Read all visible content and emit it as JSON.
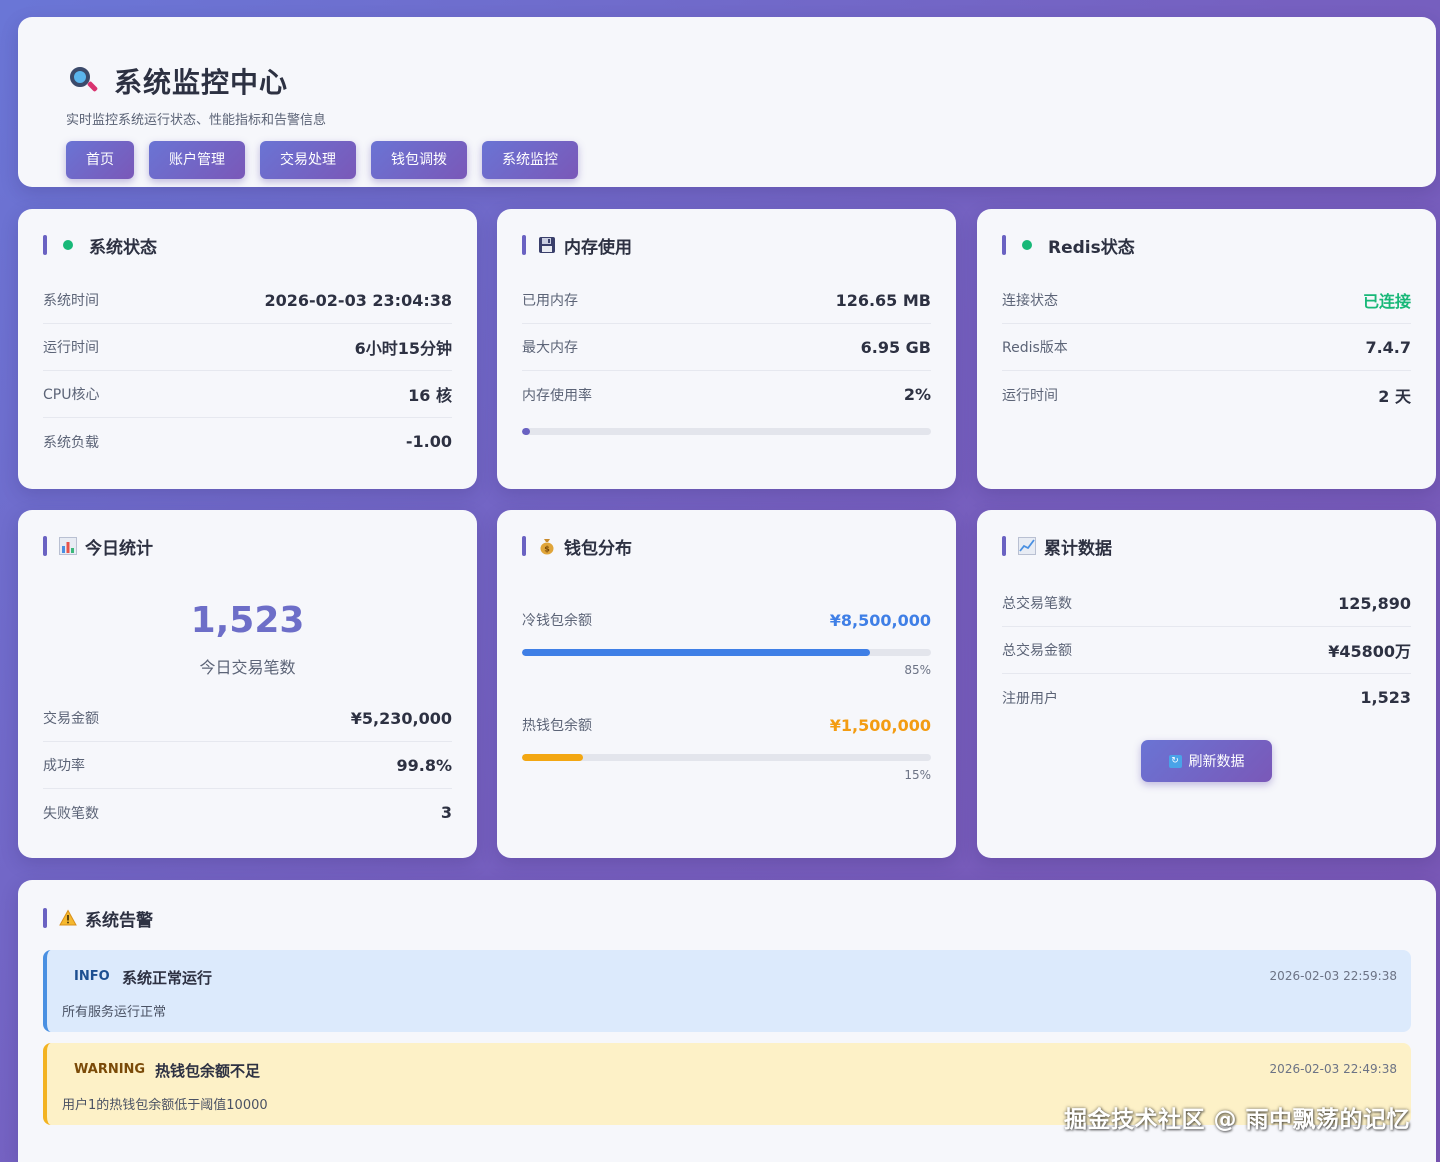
{
  "header": {
    "title": "系统监控中心",
    "subtitle": "实时监控系统运行状态、性能指标和告警信息",
    "icon": "magnifier-icon",
    "nav": [
      "首页",
      "账户管理",
      "交易处理",
      "钱包调拨",
      "系统监控"
    ]
  },
  "system_status": {
    "title": "系统状态",
    "icon": "status-dot-icon",
    "rows": [
      {
        "label": "系统时间",
        "value": "2026-02-03 23:04:38"
      },
      {
        "label": "运行时间",
        "value": "6小时15分钟"
      },
      {
        "label": "CPU核心",
        "value": "16 核"
      },
      {
        "label": "系统负载",
        "value": "-1.00"
      }
    ]
  },
  "memory": {
    "title": "内存使用",
    "icon": "floppy-disk-icon",
    "rows": [
      {
        "label": "已用内存",
        "value": "126.65 MB"
      },
      {
        "label": "最大内存",
        "value": "6.95 GB"
      },
      {
        "label": "内存使用率",
        "value": "2%"
      }
    ],
    "usage_fraction": 0.02
  },
  "redis": {
    "title": "Redis状态",
    "icon": "status-dot-icon",
    "rows": [
      {
        "label": "连接状态",
        "value": "已连接"
      },
      {
        "label": "Redis版本",
        "value": "7.4.7"
      },
      {
        "label": "运行时间",
        "value": "2 天"
      }
    ]
  },
  "today": {
    "title": "今日统计",
    "icon": "bar-chart-icon",
    "big_value": "1,523",
    "big_label": "今日交易笔数",
    "rows": [
      {
        "label": "交易金额",
        "value": "¥5,230,000"
      },
      {
        "label": "成功率",
        "value": "99.8%"
      },
      {
        "label": "失败笔数",
        "value": "3"
      }
    ]
  },
  "wallet": {
    "title": "钱包分布",
    "icon": "money-bag-icon",
    "cold": {
      "label": "冷钱包余额",
      "value": "¥8,500,000",
      "percent_text": "85%",
      "fraction": 0.85
    },
    "hot": {
      "label": "热钱包余额",
      "value": "¥1,500,000",
      "percent_text": "15%",
      "fraction": 0.15
    }
  },
  "cumulative": {
    "title": "累计数据",
    "icon": "trend-chart-icon",
    "rows": [
      {
        "label": "总交易笔数",
        "value": "125,890"
      },
      {
        "label": "总交易金额",
        "value": "¥45800万"
      },
      {
        "label": "注册用户",
        "value": "1,523"
      }
    ],
    "refresh_label": "刷新数据",
    "refresh_icon": "refresh-icon"
  },
  "alerts": {
    "title": "系统告警",
    "icon": "warning-icon",
    "items": [
      {
        "level": "INFO",
        "title": "系统正常运行",
        "message": "所有服务运行正常",
        "time": "2026-02-03 22:59:38"
      },
      {
        "level": "WARNING",
        "title": "热钱包余额不足",
        "message": "用户1的热钱包余额低于阈值10000",
        "time": "2026-02-03 22:49:38"
      }
    ]
  },
  "watermark": "掘金技术社区 @ 雨中飘荡的记忆",
  "colors": {
    "accent": "#6a62c2",
    "connected_green": "#18b878",
    "cold_blue": "#3f7fe6",
    "hot_orange": "#f39c12"
  }
}
